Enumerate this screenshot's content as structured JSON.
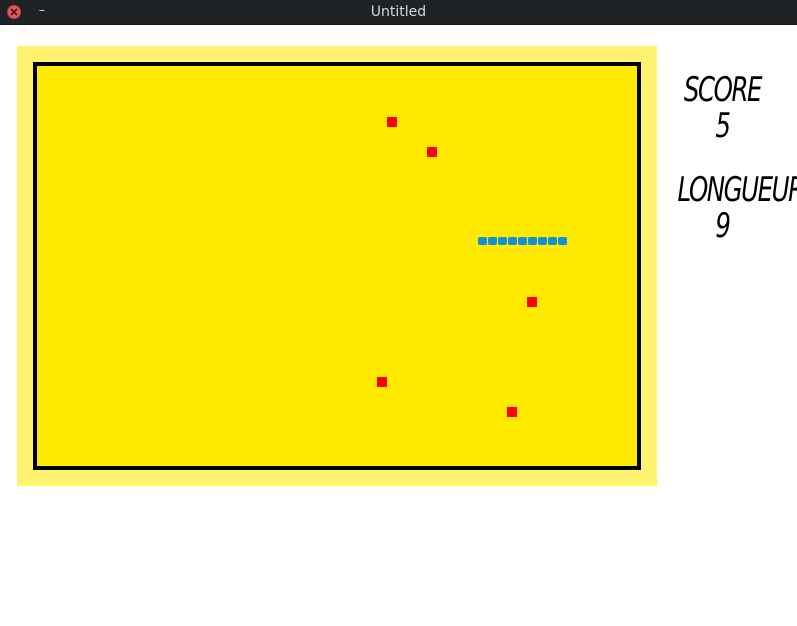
{
  "window": {
    "title": "Untitled",
    "minimize_label": "–"
  },
  "hud": {
    "score_label": "SCORE",
    "score_value": "5",
    "length_label": "LONGUEUR",
    "length_value": "9"
  },
  "game": {
    "colors": {
      "frame": "#fff271",
      "board": "#ffea00",
      "border": "#000000",
      "apple": "#ff0000",
      "snake": "#1491d2"
    },
    "apple_count": 5,
    "snake_length": 9
  }
}
